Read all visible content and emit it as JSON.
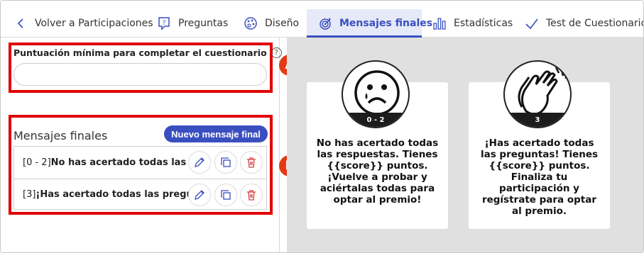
{
  "tabs": {
    "back": "Volver a Participaciones",
    "questions": "Preguntas",
    "design": "Diseño",
    "final_messages": "Mensajes finales",
    "stats": "Estadísticas",
    "test": "Test de Cuestionario"
  },
  "left": {
    "score_label": "Puntuación mínima para completar el cuestionario",
    "score_suffix": ":",
    "help_icon": "?",
    "score_value": "",
    "messages_title": "Mensajes finales",
    "new_message_button": "Nuevo mensaje final",
    "messages": [
      {
        "range": "[0 - 2]",
        "text": "No has acertado todas las resp"
      },
      {
        "range": "[3]",
        "text": "¡Has acertado todas las preguntas"
      }
    ],
    "markers": {
      "a": "A",
      "b": "B"
    }
  },
  "preview": {
    "cards": [
      {
        "range": "0 - 2",
        "text": "No has acertado todas las respuestas. Tienes {{score}} puntos. ¡Vuelve a probar y aciértalas todas para optar al premio!",
        "icon": "sad-face-icon"
      },
      {
        "range": "3",
        "text": "¡Has acertado todas las preguntas! Tienes {{score}} puntos. Finaliza tu participación y regístrate para optar al premio.",
        "icon": "clapping-hands-icon"
      }
    ]
  },
  "colors": {
    "accent": "#3a4fbf",
    "highlight": "#e00000",
    "marker": "#e23a16",
    "preview_bg": "#e0e0e0"
  }
}
